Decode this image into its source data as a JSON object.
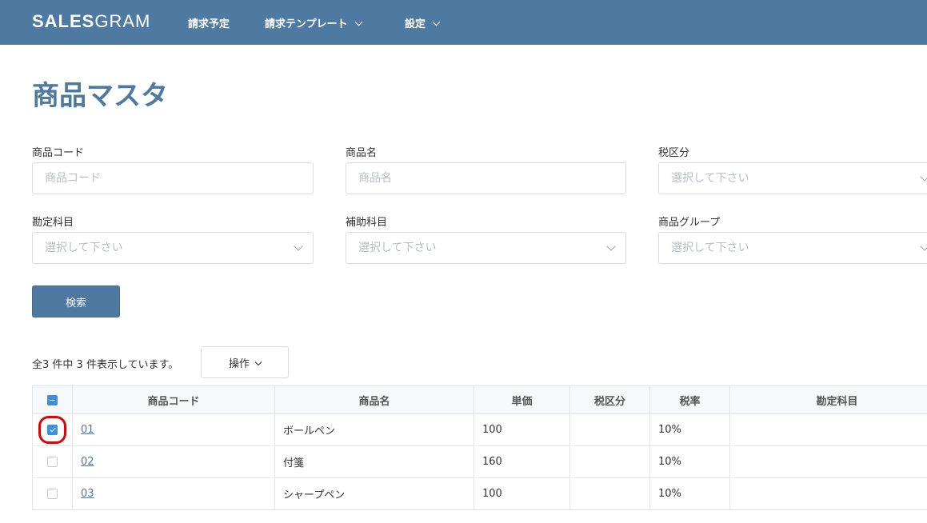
{
  "header": {
    "logo_bold": "SALES",
    "logo_light": "GRAM",
    "nav": [
      {
        "label": "請求予定"
      },
      {
        "label": "請求テンプレート"
      },
      {
        "label": "設定"
      }
    ]
  },
  "page": {
    "title": "商品マスタ"
  },
  "filters": {
    "product_code": {
      "label": "商品コード",
      "placeholder": "商品コード"
    },
    "product_name": {
      "label": "商品名",
      "placeholder": "商品名"
    },
    "tax_category": {
      "label": "税区分",
      "placeholder": "選択して下さい"
    },
    "account": {
      "label": "勘定科目",
      "placeholder": "選択して下さい"
    },
    "sub_account": {
      "label": "補助科目",
      "placeholder": "選択して下さい"
    },
    "product_group": {
      "label": "商品グループ",
      "placeholder": "選択して下さい"
    }
  },
  "search_button": "検索",
  "results": {
    "count_text": "全3 件中 3 件表示しています。",
    "operations_label": "操作"
  },
  "table": {
    "headers": [
      "商品コード",
      "商品名",
      "単価",
      "税区分",
      "税率",
      "勘定科目"
    ],
    "rows": [
      {
        "code": "01",
        "name": "ボールペン",
        "price": "100",
        "tax_category": "",
        "tax_rate": "10%",
        "account": "",
        "checked": true
      },
      {
        "code": "02",
        "name": "付箋",
        "price": "160",
        "tax_category": "",
        "tax_rate": "10%",
        "account": "",
        "checked": false
      },
      {
        "code": "03",
        "name": "シャープペン",
        "price": "100",
        "tax_category": "",
        "tax_rate": "10%",
        "account": "",
        "checked": false
      }
    ]
  },
  "colors": {
    "brand": "#4e79a0",
    "checkbox": "#3a8ee6",
    "highlight": "#e60000"
  },
  "icons": [
    "chevron-down-icon",
    "checkbox-checked-icon",
    "checkbox-indeterminate-icon"
  ]
}
